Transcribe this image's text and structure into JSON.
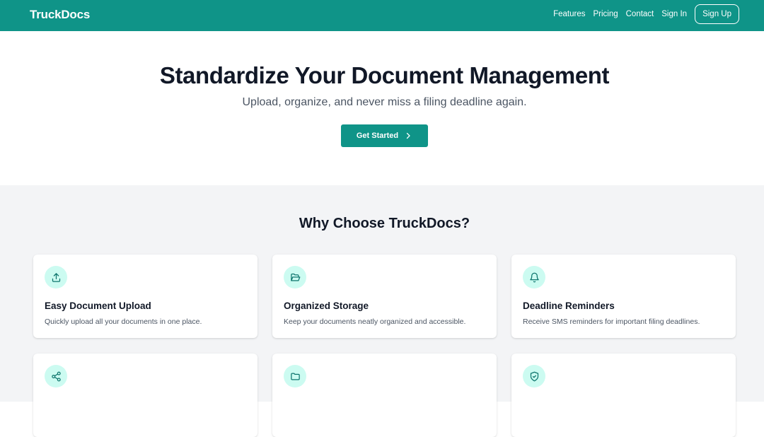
{
  "nav": {
    "brand": "TruckDocs",
    "links": [
      "Features",
      "Pricing",
      "Contact",
      "Sign In"
    ],
    "signup": "Sign Up"
  },
  "hero": {
    "title": "Standardize Your Document Management",
    "subtitle": "Upload, organize, and never miss a filing deadline again.",
    "cta": "Get Started"
  },
  "features": {
    "title": "Why Choose TruckDocs?",
    "cards": [
      {
        "icon": "upload-icon",
        "title": "Easy Document Upload",
        "desc": "Quickly upload all your documents in one place."
      },
      {
        "icon": "folder-open-icon",
        "title": "Organized Storage",
        "desc": "Keep your documents neatly organized and accessible."
      },
      {
        "icon": "bell-icon",
        "title": "Deadline Reminders",
        "desc": "Receive SMS reminders for important filing deadlines."
      },
      {
        "icon": "share-icon",
        "title": "",
        "desc": ""
      },
      {
        "icon": "folder-icon",
        "title": "",
        "desc": ""
      },
      {
        "icon": "shield-check-icon",
        "title": "",
        "desc": ""
      }
    ]
  },
  "colors": {
    "brand": "#0f9488",
    "icon_bg": "#ccfbf1",
    "section_bg": "#f3f4f6"
  }
}
